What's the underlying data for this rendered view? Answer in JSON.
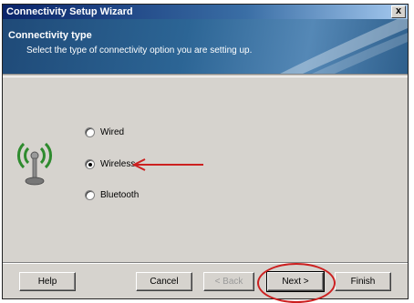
{
  "window": {
    "title": "Connectivity Setup Wizard",
    "close_label": "x"
  },
  "banner": {
    "title": "Connectivity type",
    "subtitle": "Select the type of connectivity option you are setting up."
  },
  "options": [
    {
      "label": "Wired",
      "checked": false
    },
    {
      "label": "Wireless",
      "checked": true
    },
    {
      "label": "Bluetooth",
      "checked": false
    }
  ],
  "buttons": {
    "help": "Help",
    "cancel": "Cancel",
    "back": "< Back",
    "next": "Next >",
    "finish": "Finish"
  },
  "icons": {
    "connectivity": "wireless-antenna-icon"
  },
  "colors": {
    "annotation": "#cc2020",
    "title_bar": "#0a246a",
    "banner": "#2c6595"
  }
}
